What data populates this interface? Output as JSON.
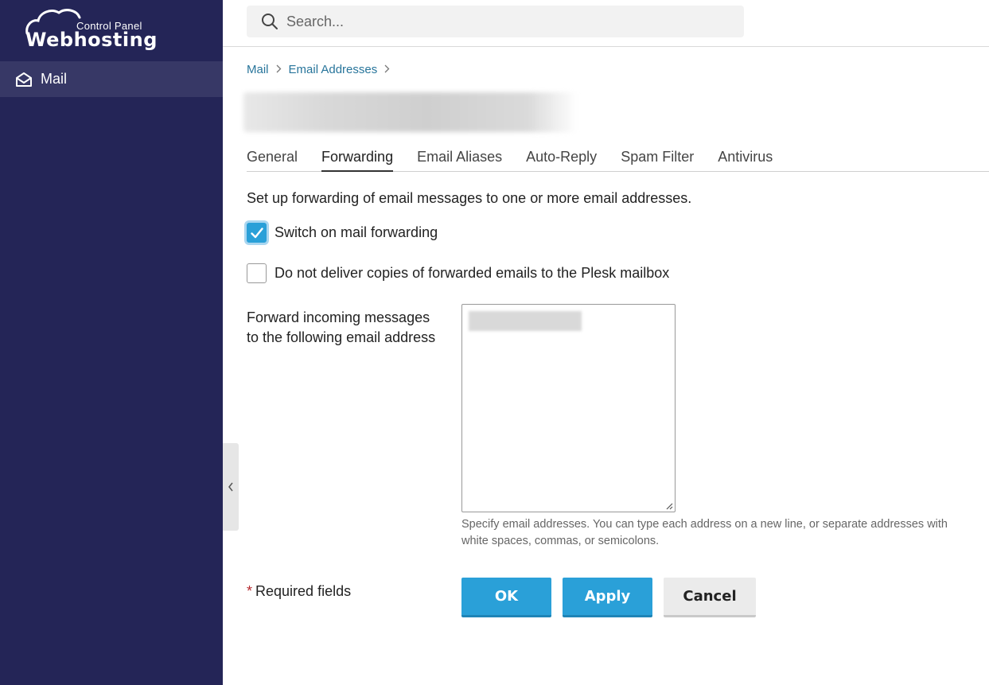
{
  "brand": {
    "logo_top": "Control Panel",
    "logo_main": "Webhosting"
  },
  "sidebar": {
    "items": [
      {
        "label": "Mail",
        "icon": "envelope-open-icon",
        "active": true
      }
    ]
  },
  "search": {
    "placeholder": "Search..."
  },
  "breadcrumb": {
    "items": [
      "Mail",
      "Email Addresses"
    ]
  },
  "tabs": [
    {
      "label": "General"
    },
    {
      "label": "Forwarding",
      "active": true
    },
    {
      "label": "Email Aliases"
    },
    {
      "label": "Auto-Reply"
    },
    {
      "label": "Spam Filter"
    },
    {
      "label": "Antivirus"
    }
  ],
  "forwarding": {
    "intro": "Set up forwarding of email messages to one or more email addresses.",
    "switch_on": {
      "label": "Switch on mail forwarding",
      "checked": true
    },
    "no_copies": {
      "label": "Do not deliver copies of forwarded emails to the Plesk mailbox",
      "checked": false
    },
    "field_label": "Forward incoming messages to the following email address",
    "hint": "Specify email addresses. You can type each address on a new line, or separate addresses with white spaces, commas, or semicolons."
  },
  "footer": {
    "required_star": "*",
    "required_text": "Required fields",
    "ok_label": "OK",
    "apply_label": "Apply",
    "cancel_label": "Cancel"
  },
  "colors": {
    "sidebar_bg": "#242557",
    "sidebar_active": "#373866",
    "primary": "#2aa0d8",
    "link": "#28759b",
    "required_star": "#b5272d"
  }
}
